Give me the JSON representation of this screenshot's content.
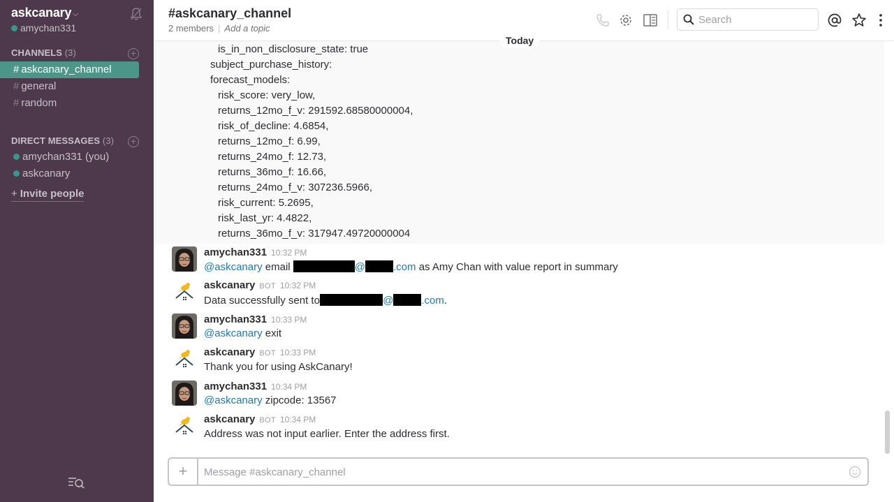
{
  "team": {
    "name": "askcanary",
    "user": "amychan331"
  },
  "sidebar": {
    "channels_title": "CHANNELS",
    "channels_count": "(3)",
    "channels": [
      {
        "hash": "#",
        "label": "askcanary_channel"
      },
      {
        "hash": "#",
        "label": "general"
      },
      {
        "hash": "#",
        "label": "random"
      }
    ],
    "dm_title": "DIRECT MESSAGES",
    "dm_count": "(3)",
    "dms": [
      {
        "label": "amychan331 (you)"
      },
      {
        "label": "askcanary"
      }
    ],
    "invite_label": "Invite people"
  },
  "header": {
    "title": "#askcanary_channel",
    "members": "2 members",
    "sep": "|",
    "topic": "Add a topic",
    "search_placeholder": "Search"
  },
  "day_divider": "Today",
  "code_lines": [
    "is_in_non_disclosure_state: true",
    "subject_purchase_history:",
    "forecast_models:",
    "risk_score: very_low,",
    "returns_12mo_f_v: 291592.68580000004,",
    "risk_of_decline: 4.6854,",
    "returns_12mo_f: 6.99,",
    "returns_24mo_f: 12.73,",
    "returns_36mo_f: 16.66,",
    "returns_24mo_f_v: 307236.5966,",
    "risk_current: 5.2695,",
    "risk_last_yr: 4.4822,",
    "returns_36mo_f_v: 317947.49720000004"
  ],
  "messages": [
    {
      "author": "amychan331",
      "bot": "",
      "time": "10:32 PM",
      "mention": "@askcanary",
      "text_a": " email ",
      "at": "@",
      "domain": ".com",
      "text_b": " as Amy Chan with value report in summary"
    },
    {
      "author": "askcanary",
      "bot": "BOT",
      "time": "10:32 PM",
      "text_a": "Data successfully sent to ",
      "at": "@",
      "domain": ".com",
      "text_b": "."
    },
    {
      "author": "amychan331",
      "bot": "",
      "time": "10:33 PM",
      "mention": "@askcanary",
      "text": " exit"
    },
    {
      "author": "askcanary",
      "bot": "BOT",
      "time": "10:33 PM",
      "text": "Thank you for using AskCanary!"
    },
    {
      "author": "amychan331",
      "bot": "",
      "time": "10:34 PM",
      "mention": "@askcanary",
      "text": " zipcode: 13567"
    },
    {
      "author": "askcanary",
      "bot": "BOT",
      "time": "10:34 PM",
      "text": "Address was not input earlier. Enter the address first."
    }
  ],
  "composer": {
    "plus": "+",
    "placeholder": "Message #askcanary_channel"
  },
  "icons": {
    "bell": "bell-icon",
    "call": "phone-icon",
    "settings": "gear-icon",
    "details": "sidebar-panel-icon",
    "search": "search-icon",
    "mentions": "at-icon",
    "starred": "star-icon",
    "more": "more-vertical-icon",
    "emoji": "smiley-icon",
    "quick_switcher": "quick-switcher-icon"
  },
  "colors": {
    "sidebar": "#4d394b",
    "active_channel": "#4c9689",
    "presence": "#38978d",
    "link": "#1d78b8"
  }
}
